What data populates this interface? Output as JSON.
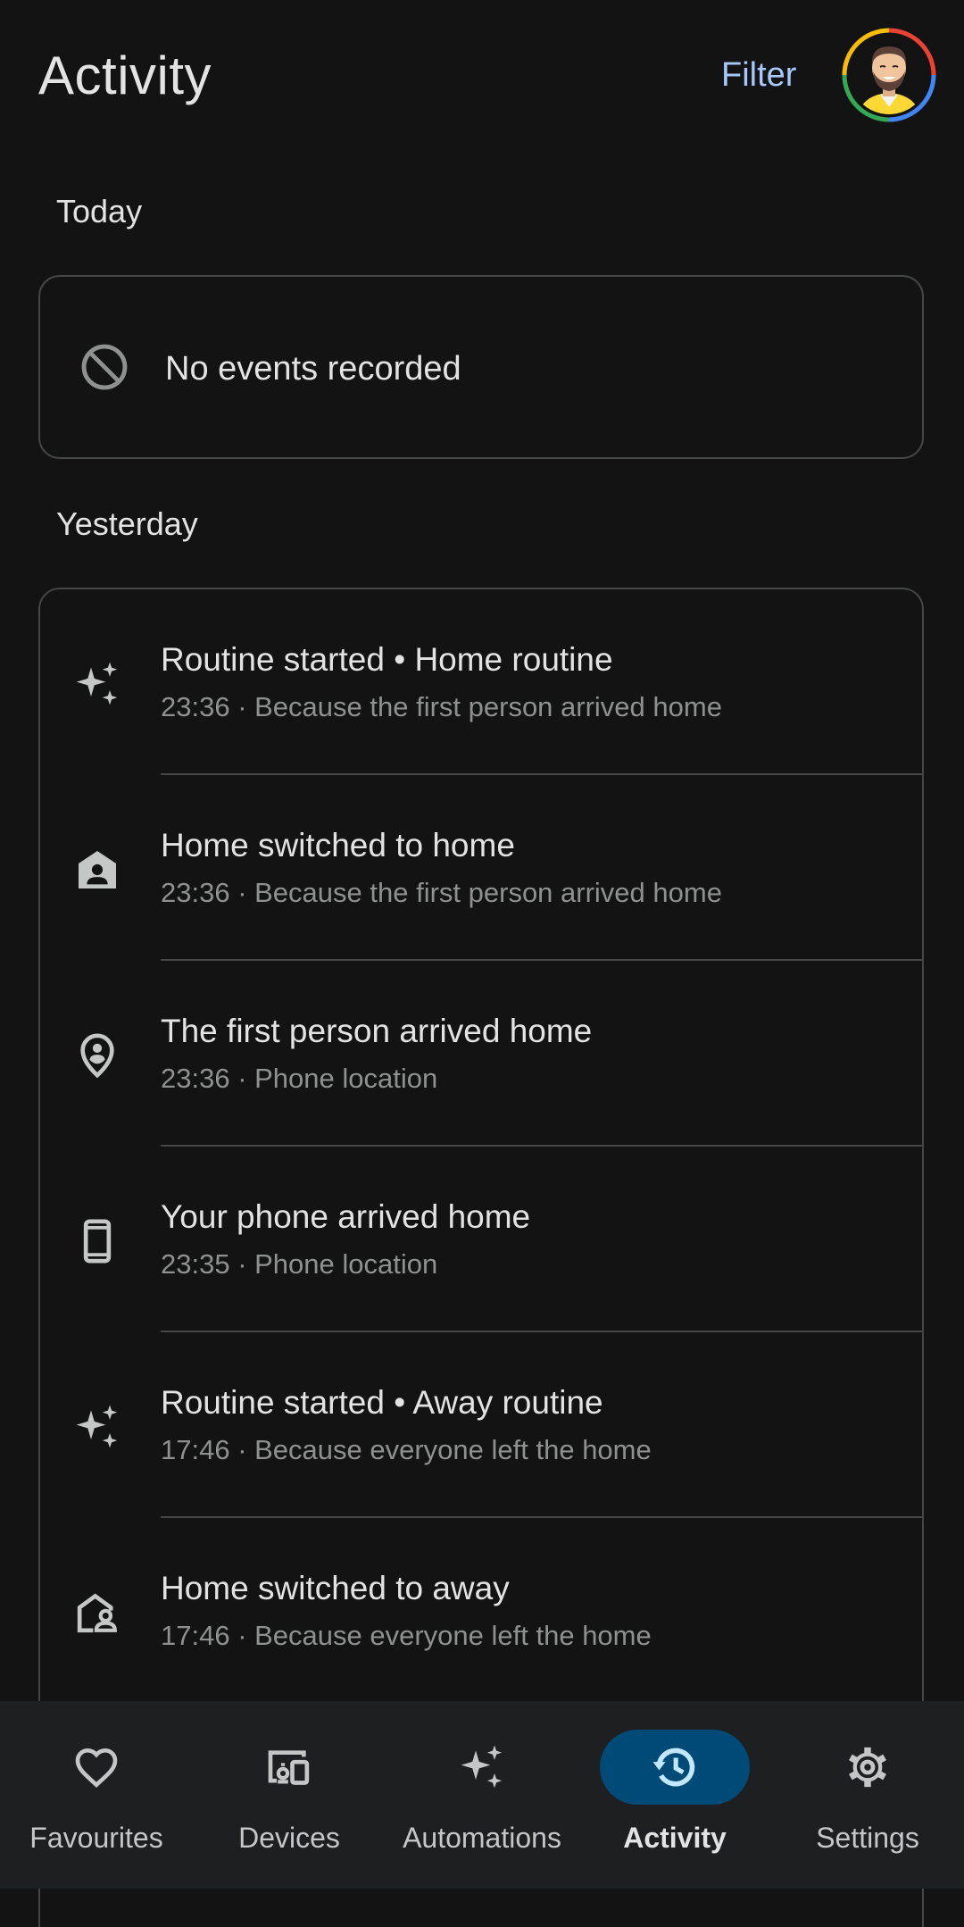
{
  "header": {
    "title": "Activity",
    "filter_label": "Filter"
  },
  "sections": {
    "today": {
      "title": "Today",
      "empty_message": "No events recorded"
    },
    "yesterday": {
      "title": "Yesterday",
      "events": [
        {
          "icon": "sparkle-icon",
          "title": "Routine started • Home routine",
          "subtitle": "23:36 · Because the first person arrived home"
        },
        {
          "icon": "home-person-icon",
          "title": "Home switched to home",
          "subtitle": "23:36 · Because the first person arrived home"
        },
        {
          "icon": "person-pin-icon",
          "title": "The first person arrived home",
          "subtitle": "23:36 · Phone location"
        },
        {
          "icon": "phone-icon",
          "title": "Your phone arrived home",
          "subtitle": "23:35 · Phone location"
        },
        {
          "icon": "sparkle-icon",
          "title": "Routine started • Away routine",
          "subtitle": "17:46 · Because everyone left the home"
        },
        {
          "icon": "home-away-icon",
          "title": "Home switched to away",
          "subtitle": "17:46 · Because everyone left the home"
        }
      ]
    }
  },
  "nav": {
    "items": [
      {
        "label": "Favourites",
        "icon": "heart-icon",
        "active": false
      },
      {
        "label": "Devices",
        "icon": "devices-icon",
        "active": false
      },
      {
        "label": "Automations",
        "icon": "sparkle-icon",
        "active": false
      },
      {
        "label": "Activity",
        "icon": "history-icon",
        "active": true
      },
      {
        "label": "Settings",
        "icon": "gear-icon",
        "active": false
      }
    ]
  },
  "colors": {
    "background": "#131314",
    "accent": "#a8c7fa",
    "active_nav_pill": "#004a77",
    "nav_background": "#1e1f20"
  }
}
